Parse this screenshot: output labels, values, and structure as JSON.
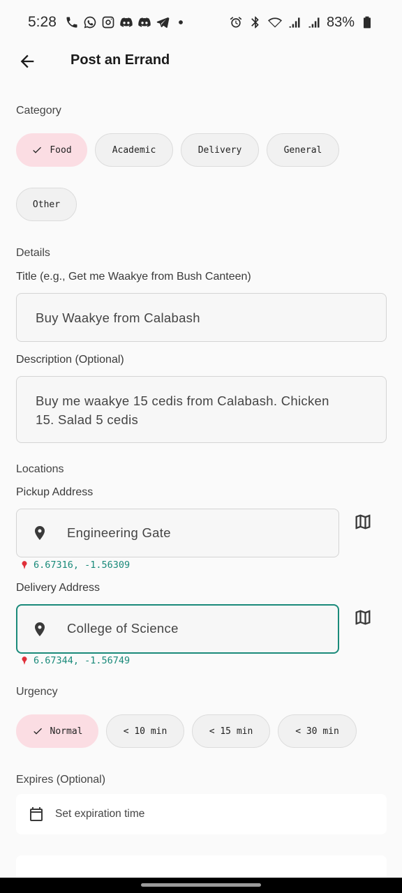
{
  "status_bar": {
    "time": "5:28",
    "left_icons": [
      "phone-icon",
      "whatsapp-icon",
      "instagram-icon",
      "discord-icon",
      "discord-icon",
      "telegram-icon",
      "dot-icon"
    ],
    "right_icons": [
      "alarm-icon",
      "bluetooth-icon",
      "wifi-icon",
      "signal-icon",
      "signal-icon",
      "battery-icon"
    ],
    "battery": "83%"
  },
  "app_bar": {
    "title": "Post an Errand"
  },
  "category": {
    "label": "Category",
    "chips": [
      {
        "label": "Food",
        "selected": true
      },
      {
        "label": "Academic",
        "selected": false
      },
      {
        "label": "Delivery",
        "selected": false
      },
      {
        "label": "General",
        "selected": false
      },
      {
        "label": "Other",
        "selected": false
      }
    ]
  },
  "details": {
    "label": "Details",
    "title_label": "Title (e.g., Get me Waakye from Bush Canteen)",
    "title_value": "Buy Waakye from Calabash",
    "description_label": "Description (Optional)",
    "description_line1": "Buy me waakye 15 cedis from Calabash. Chicken",
    "description_line2": "15. Salad 5 cedis"
  },
  "locations": {
    "label": "Locations",
    "pickup_label": "Pickup Address",
    "pickup_value": "Engineering Gate",
    "pickup_coords": "6.67316, -1.56309",
    "delivery_label": "Delivery Address",
    "delivery_value": "College of Science",
    "delivery_coords": "6.67344, -1.56749"
  },
  "urgency": {
    "label": "Urgency",
    "chips": [
      {
        "label": "Normal",
        "selected": true
      },
      {
        "label": "< 10 min",
        "selected": false
      },
      {
        "label": "< 15 min",
        "selected": false
      },
      {
        "label": "< 30 min",
        "selected": false
      }
    ]
  },
  "expires": {
    "label": "Expires (Optional)",
    "placeholder": "Set expiration time"
  },
  "colors": {
    "accent": "#1a8a7a",
    "chip_selected": "#fbdde3",
    "chip_default": "#f1f1f1",
    "background": "#fafafa"
  }
}
